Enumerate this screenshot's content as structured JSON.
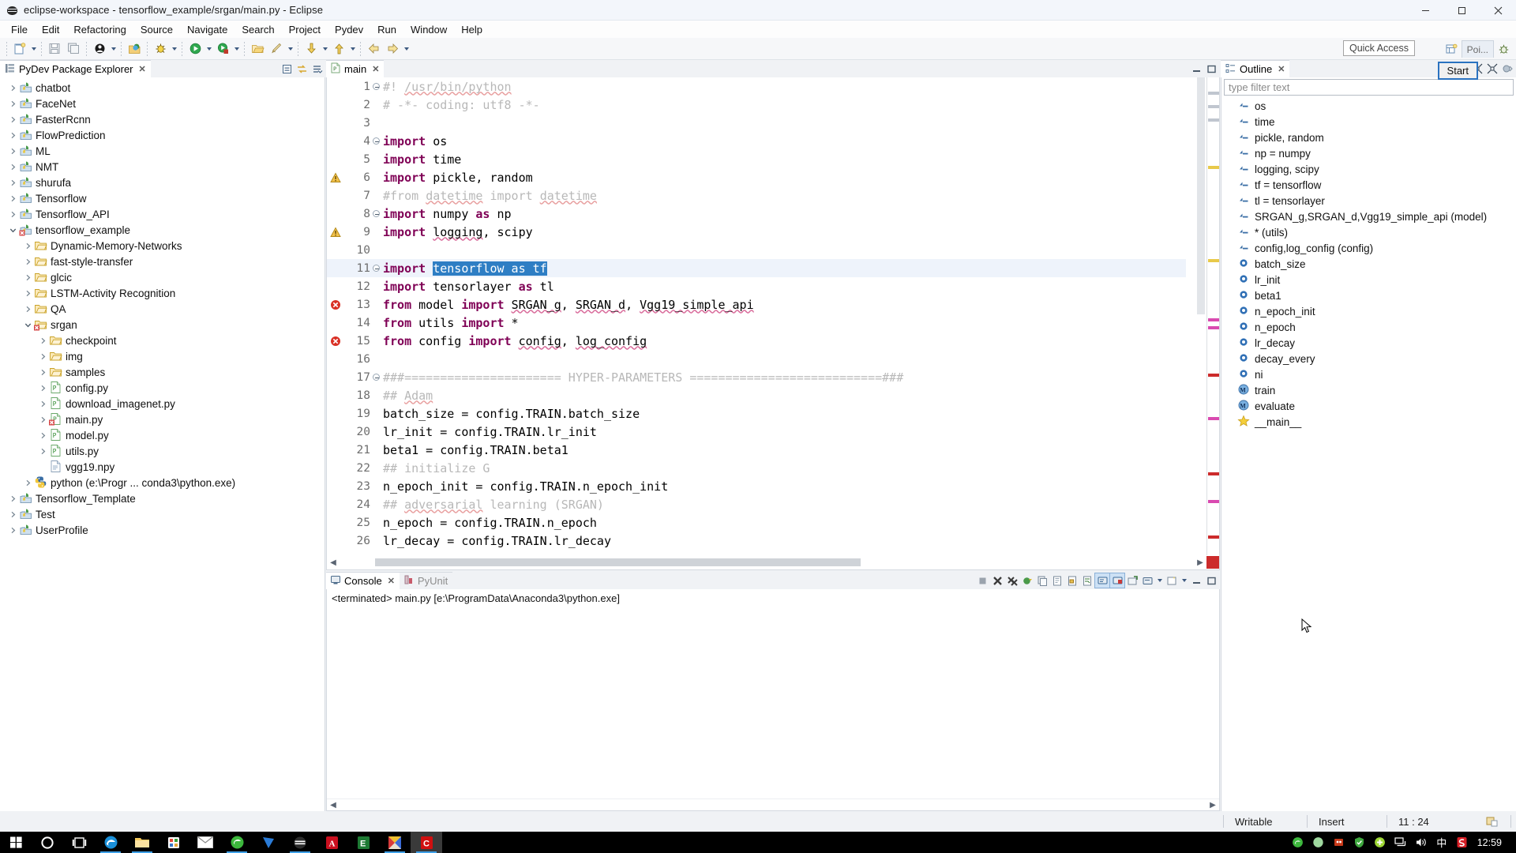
{
  "window": {
    "title": "eclipse-workspace - tensorflow_example/srgan/main.py - Eclipse",
    "app_icon": "eclipse-icon",
    "minimize": "minimize-button",
    "maximize": "maximize-button",
    "close": "close-button"
  },
  "menubar": {
    "items": [
      "File",
      "Edit",
      "Refactoring",
      "Source",
      "Navigate",
      "Search",
      "Project",
      "Pydev",
      "Run",
      "Window",
      "Help"
    ]
  },
  "toolbar": {
    "quick_access": "Quick Access",
    "perspective_label": "Poi...",
    "icons": [
      "new-wizard-icon",
      "save-icon",
      "save-all-icon",
      "open-type-icon",
      "debug-icon",
      "run-icon",
      "coverage-icon",
      "open-resource-icon",
      "external-tools-icon",
      "next-annotation-icon",
      "previous-annotation-icon",
      "back-icon",
      "forward-icon"
    ]
  },
  "package_explorer": {
    "title": "PyDev Package Explorer",
    "toolbar_icons": [
      "collapse-all-icon",
      "link-with-editor-icon",
      "view-menu-icon"
    ],
    "tree": [
      {
        "label": "chatbot",
        "icon": "pydev-project-icon",
        "depth": 0,
        "state": "collapsed"
      },
      {
        "label": "FaceNet",
        "icon": "pydev-project-icon",
        "depth": 0,
        "state": "collapsed"
      },
      {
        "label": "FasterRcnn",
        "icon": "pydev-project-icon",
        "depth": 0,
        "state": "collapsed"
      },
      {
        "label": "FlowPrediction",
        "icon": "pydev-project-icon",
        "depth": 0,
        "state": "collapsed"
      },
      {
        "label": "ML",
        "icon": "pydev-project-icon",
        "depth": 0,
        "state": "collapsed"
      },
      {
        "label": "NMT",
        "icon": "pydev-project-icon",
        "depth": 0,
        "state": "collapsed"
      },
      {
        "label": "shurufa",
        "icon": "pydev-project-icon",
        "depth": 0,
        "state": "collapsed"
      },
      {
        "label": "Tensorflow",
        "icon": "pydev-project-icon",
        "depth": 0,
        "state": "collapsed"
      },
      {
        "label": "Tensorflow_API",
        "icon": "pydev-project-icon",
        "depth": 0,
        "state": "collapsed"
      },
      {
        "label": "tensorflow_example",
        "icon": "pydev-project-error-icon",
        "depth": 0,
        "state": "expanded"
      },
      {
        "label": "Dynamic-Memory-Networks",
        "icon": "folder-icon",
        "depth": 1,
        "state": "collapsed"
      },
      {
        "label": "fast-style-transfer",
        "icon": "folder-icon",
        "depth": 1,
        "state": "collapsed"
      },
      {
        "label": "glcic",
        "icon": "folder-icon",
        "depth": 1,
        "state": "collapsed"
      },
      {
        "label": "LSTM-Activity Recognition",
        "icon": "folder-icon",
        "depth": 1,
        "state": "collapsed"
      },
      {
        "label": "QA",
        "icon": "folder-icon",
        "depth": 1,
        "state": "collapsed"
      },
      {
        "label": "srgan",
        "icon": "folder-error-icon",
        "depth": 1,
        "state": "expanded"
      },
      {
        "label": "checkpoint",
        "icon": "folder-icon",
        "depth": 2,
        "state": "collapsed"
      },
      {
        "label": "img",
        "icon": "folder-icon",
        "depth": 2,
        "state": "collapsed"
      },
      {
        "label": "samples",
        "icon": "folder-icon",
        "depth": 2,
        "state": "collapsed"
      },
      {
        "label": "config.py",
        "icon": "python-file-icon",
        "depth": 2,
        "state": "collapsed"
      },
      {
        "label": "download_imagenet.py",
        "icon": "python-file-icon",
        "depth": 2,
        "state": "collapsed"
      },
      {
        "label": "main.py",
        "icon": "python-file-error-icon",
        "depth": 2,
        "state": "collapsed"
      },
      {
        "label": "model.py",
        "icon": "python-file-icon",
        "depth": 2,
        "state": "collapsed"
      },
      {
        "label": "utils.py",
        "icon": "python-file-icon",
        "depth": 2,
        "state": "collapsed"
      },
      {
        "label": "vgg19.npy",
        "icon": "generic-file-icon",
        "depth": 2,
        "state": "leaf"
      },
      {
        "label": "python  (e:\\Progr ... conda3\\python.exe)",
        "icon": "python-interpreter-icon",
        "depth": 1,
        "state": "collapsed"
      },
      {
        "label": "Tensorflow_Template",
        "icon": "pydev-project-icon",
        "depth": 0,
        "state": "collapsed"
      },
      {
        "label": "Test",
        "icon": "pydev-project-icon",
        "depth": 0,
        "state": "collapsed"
      },
      {
        "label": "UserProfile",
        "icon": "pydev-project-icon",
        "depth": 0,
        "state": "collapsed"
      }
    ]
  },
  "editor": {
    "tab_label": "main",
    "tab_icon": "python-file-icon",
    "minimize": "minimize-icon",
    "maximize": "maximize-icon",
    "current_line": 11,
    "lines": [
      {
        "n": 1,
        "fold": true,
        "marker": "",
        "segments": [
          {
            "t": "#! ",
            "c": "cmt"
          },
          {
            "t": "/usr/bin/python",
            "c": "cmt-u"
          }
        ]
      },
      {
        "n": 2,
        "fold": false,
        "marker": "",
        "segments": [
          {
            "t": "# -*- coding: utf8 -*-",
            "c": "cmt"
          }
        ]
      },
      {
        "n": 3,
        "fold": false,
        "marker": "",
        "segments": []
      },
      {
        "n": 4,
        "fold": true,
        "marker": "",
        "segments": [
          {
            "t": "import",
            "c": "kw"
          },
          {
            "t": " os",
            "c": ""
          }
        ]
      },
      {
        "n": 5,
        "fold": false,
        "marker": "",
        "segments": [
          {
            "t": "import",
            "c": "kw"
          },
          {
            "t": " time",
            "c": ""
          }
        ]
      },
      {
        "n": 6,
        "fold": false,
        "marker": "warn",
        "segments": [
          {
            "t": "import",
            "c": "kw"
          },
          {
            "t": " pickle, random",
            "c": ""
          }
        ]
      },
      {
        "n": 7,
        "fold": false,
        "marker": "",
        "segments": [
          {
            "t": "#from ",
            "c": "cmt"
          },
          {
            "t": "datetime",
            "c": "cmt-u"
          },
          {
            "t": " import ",
            "c": "cmt"
          },
          {
            "t": "datetime",
            "c": "cmt-u"
          }
        ]
      },
      {
        "n": 8,
        "fold": true,
        "marker": "",
        "segments": [
          {
            "t": "import",
            "c": "kw"
          },
          {
            "t": " numpy ",
            "c": ""
          },
          {
            "t": "as",
            "c": "kw"
          },
          {
            "t": " np",
            "c": ""
          }
        ]
      },
      {
        "n": 9,
        "fold": false,
        "marker": "warn",
        "segments": [
          {
            "t": "import",
            "c": "kw"
          },
          {
            "t": " ",
            "c": ""
          },
          {
            "t": "logging",
            "c": "und"
          },
          {
            "t": ", scipy",
            "c": ""
          }
        ]
      },
      {
        "n": 10,
        "fold": false,
        "marker": "",
        "segments": []
      },
      {
        "n": 11,
        "fold": true,
        "marker": "",
        "segments": [
          {
            "t": "import",
            "c": "kw"
          },
          {
            "t": " ",
            "c": ""
          },
          {
            "t": "tensorflow as tf",
            "c": "sel"
          }
        ]
      },
      {
        "n": 12,
        "fold": false,
        "marker": "",
        "segments": [
          {
            "t": "import",
            "c": "kw"
          },
          {
            "t": " tensorlayer ",
            "c": ""
          },
          {
            "t": "as",
            "c": "kw"
          },
          {
            "t": " tl",
            "c": ""
          }
        ]
      },
      {
        "n": 13,
        "fold": false,
        "marker": "err",
        "segments": [
          {
            "t": "from",
            "c": "kw"
          },
          {
            "t": " model ",
            "c": ""
          },
          {
            "t": "import",
            "c": "kw"
          },
          {
            "t": " ",
            "c": ""
          },
          {
            "t": "SRGAN_g",
            "c": "und"
          },
          {
            "t": ", ",
            "c": ""
          },
          {
            "t": "SRGAN_d",
            "c": "und"
          },
          {
            "t": ", ",
            "c": ""
          },
          {
            "t": "Vgg19_simple_api",
            "c": "und"
          }
        ]
      },
      {
        "n": 14,
        "fold": false,
        "marker": "",
        "segments": [
          {
            "t": "from",
            "c": "kw"
          },
          {
            "t": " utils ",
            "c": ""
          },
          {
            "t": "import",
            "c": "kw"
          },
          {
            "t": " *",
            "c": ""
          }
        ]
      },
      {
        "n": 15,
        "fold": false,
        "marker": "err",
        "segments": [
          {
            "t": "from",
            "c": "kw"
          },
          {
            "t": " config ",
            "c": ""
          },
          {
            "t": "import",
            "c": "kw"
          },
          {
            "t": " ",
            "c": ""
          },
          {
            "t": "config",
            "c": "und"
          },
          {
            "t": ", ",
            "c": ""
          },
          {
            "t": "log_config",
            "c": "und"
          }
        ]
      },
      {
        "n": 16,
        "fold": false,
        "marker": "",
        "segments": []
      },
      {
        "n": 17,
        "fold": true,
        "marker": "",
        "segments": [
          {
            "t": "###====================== HYPER-PARAMETERS ===========================###",
            "c": "cmt"
          }
        ]
      },
      {
        "n": 18,
        "fold": false,
        "marker": "",
        "segments": [
          {
            "t": "## ",
            "c": "cmt"
          },
          {
            "t": "Adam",
            "c": "cmt-u"
          }
        ]
      },
      {
        "n": 19,
        "fold": false,
        "marker": "",
        "segments": [
          {
            "t": "batch_size = config.TRAIN.batch_size",
            "c": ""
          }
        ]
      },
      {
        "n": 20,
        "fold": false,
        "marker": "",
        "segments": [
          {
            "t": "lr_init = config.TRAIN.lr_init",
            "c": ""
          }
        ]
      },
      {
        "n": 21,
        "fold": false,
        "marker": "",
        "segments": [
          {
            "t": "beta1 = config.TRAIN.beta1",
            "c": ""
          }
        ]
      },
      {
        "n": 22,
        "fold": false,
        "marker": "",
        "segments": [
          {
            "t": "## initialize G",
            "c": "cmt"
          }
        ]
      },
      {
        "n": 23,
        "fold": false,
        "marker": "",
        "segments": [
          {
            "t": "n_epoch_init = config.TRAIN.n_epoch_init",
            "c": ""
          }
        ]
      },
      {
        "n": 24,
        "fold": false,
        "marker": "",
        "segments": [
          {
            "t": "## ",
            "c": "cmt"
          },
          {
            "t": "adversarial",
            "c": "cmt-u"
          },
          {
            "t": " learning (SRGAN)",
            "c": "cmt"
          }
        ]
      },
      {
        "n": 25,
        "fold": false,
        "marker": "",
        "segments": [
          {
            "t": "n_epoch = config.TRAIN.n_epoch",
            "c": ""
          }
        ]
      },
      {
        "n": 26,
        "fold": false,
        "marker": "",
        "segments": [
          {
            "t": "lr_decay = config.TRAIN.lr_decay",
            "c": ""
          }
        ]
      }
    ]
  },
  "outline": {
    "title": "Outline",
    "filter_placeholder": "type filter text",
    "toolbar_icons": [
      "sort-icon",
      "collapse-all-icon",
      "expand-all-icon",
      "view-menu-icon"
    ],
    "start_tooltip": "Start",
    "items": [
      {
        "label": "os",
        "icon": "import-icon"
      },
      {
        "label": "time",
        "icon": "import-icon"
      },
      {
        "label": "pickle, random",
        "icon": "import-icon"
      },
      {
        "label": "np = numpy",
        "icon": "import-icon"
      },
      {
        "label": "logging, scipy",
        "icon": "import-icon"
      },
      {
        "label": "tf = tensorflow",
        "icon": "import-icon"
      },
      {
        "label": "tl = tensorlayer",
        "icon": "import-icon"
      },
      {
        "label": "SRGAN_g,SRGAN_d,Vgg19_simple_api (model)",
        "icon": "import-icon"
      },
      {
        "label": "* (utils)",
        "icon": "import-icon"
      },
      {
        "label": "config,log_config (config)",
        "icon": "import-icon"
      },
      {
        "label": "batch_size",
        "icon": "attribute-icon"
      },
      {
        "label": "lr_init",
        "icon": "attribute-icon"
      },
      {
        "label": "beta1",
        "icon": "attribute-icon"
      },
      {
        "label": "n_epoch_init",
        "icon": "attribute-icon"
      },
      {
        "label": "n_epoch",
        "icon": "attribute-icon"
      },
      {
        "label": "lr_decay",
        "icon": "attribute-icon"
      },
      {
        "label": "decay_every",
        "icon": "attribute-icon"
      },
      {
        "label": "ni",
        "icon": "attribute-icon"
      },
      {
        "label": "train",
        "icon": "method-icon"
      },
      {
        "label": "evaluate",
        "icon": "method-icon"
      },
      {
        "label": "__main__",
        "icon": "main-star-icon"
      }
    ]
  },
  "console": {
    "tabs": [
      {
        "label": "Console",
        "icon": "console-icon",
        "active": true
      },
      {
        "label": "PyUnit",
        "icon": "pyunit-icon",
        "active": false
      }
    ],
    "output": "<terminated> main.py [e:\\ProgramData\\Anaconda3\\python.exe]",
    "toolbar_icons": [
      "terminate-icon",
      "remove-launch-icon",
      "remove-all-terminated-icon",
      "relaunch-icon",
      "copy-icon",
      "clear-console-icon",
      "lock-scroll-icon",
      "word-wrap-icon",
      "show-console-icon",
      "pin-console-icon",
      "display-selected-console-icon",
      "open-console-icon",
      "view-menu-icon",
      "minimize-icon",
      "maximize-icon"
    ]
  },
  "statusbar": {
    "writable": "Writable",
    "insert": "Insert",
    "position": "11 : 24",
    "indicator_icon": "smart-insert-icon"
  },
  "taskbar": {
    "start": "windows-start-icon",
    "items": [
      "cortana-search-icon",
      "task-view-icon",
      "edge-icon",
      "file-explorer-icon",
      "microsoft-store-icon",
      "mail-icon",
      "sogou-browser-icon",
      "wps-icon",
      "eclipse-icon",
      "acrobat-icon",
      "excel-icon",
      "paint-icon",
      "eclipse-active-icon"
    ],
    "tray": [
      "sogou-icon",
      "qq-icon",
      "thunder-icon",
      "shield-icon",
      "update-icon",
      "network-icon",
      "volume-icon",
      "ime-chinese-icon",
      "sogou-input-icon"
    ],
    "ime_label": "中",
    "clock": "12:59"
  },
  "colors": {
    "accent": "#2e7ec4",
    "keyword": "#7f0055",
    "comment": "#b8b8b8",
    "selection": "#2e7ec4",
    "error": "#cc3333",
    "warning": "#e8b130",
    "taskbar_bg": "#000000"
  }
}
